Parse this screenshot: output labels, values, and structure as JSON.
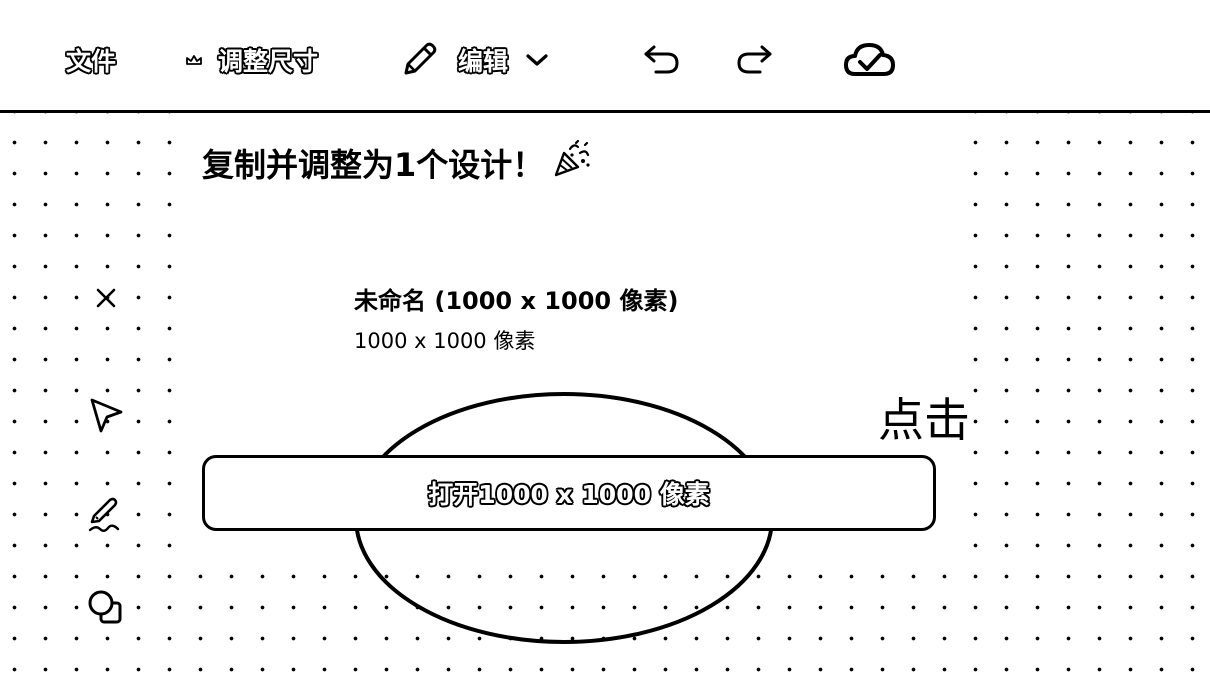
{
  "toolbar": {
    "file_label": "文件",
    "resize_label": "调整尺寸",
    "edit_label": "编辑",
    "icons": {
      "resize": "crown-icon",
      "edit": "pencil-icon",
      "edit_menu": "chevron-down-icon",
      "undo": "undo-icon",
      "redo": "redo-icon",
      "sync": "cloud-check-icon"
    }
  },
  "sidebar": {
    "icons": [
      "close-icon",
      "pointer-icon",
      "draw-icon",
      "shapes-icon"
    ]
  },
  "panel": {
    "title": "复制并调整为1个设计！",
    "title_emoji": "party-popper-icon",
    "design_name": "未命名 (1000 x 1000 像素)",
    "design_size": "1000 x 1000 像素",
    "open_button_label": "打开1000 x 1000 像素"
  },
  "annotation": {
    "click_note": "点击"
  }
}
